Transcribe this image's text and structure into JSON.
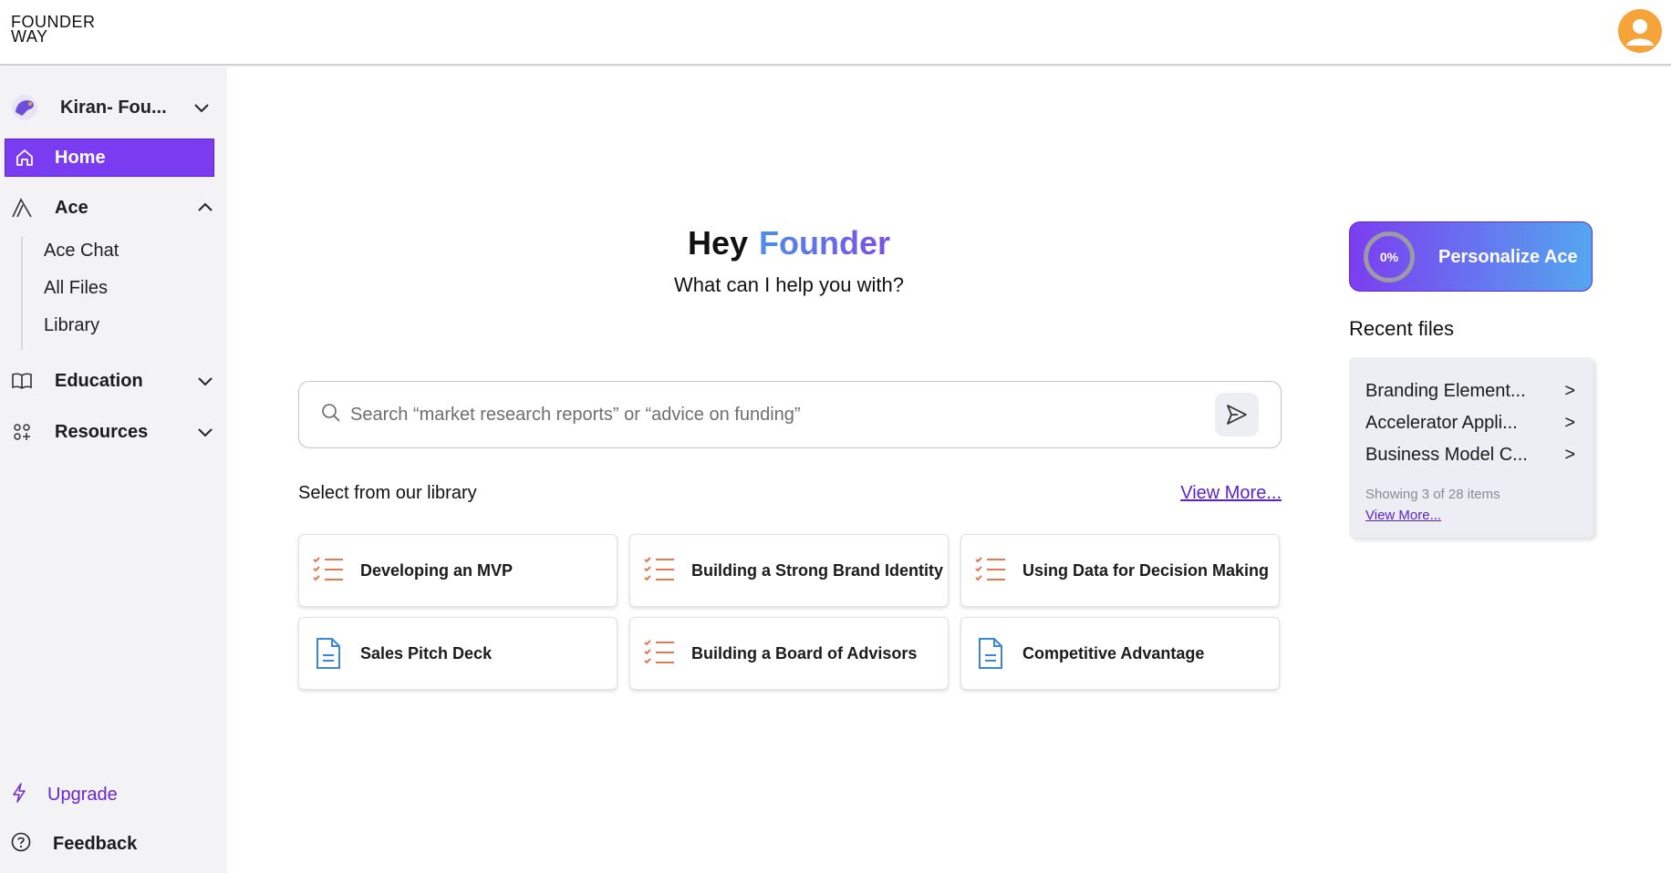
{
  "header": {
    "logo_line1": "FOUNDER",
    "logo_line2": "WAY",
    "avatar_icon": "user-avatar-icon"
  },
  "sidebar": {
    "workspace_name": "Kiran- Fou...",
    "home": "Home",
    "ace": "Ace",
    "ace_items": [
      "Ace Chat",
      "All Files",
      "Library"
    ],
    "education": "Education",
    "resources": "Resources",
    "upgrade": "Upgrade",
    "feedback": "Feedback"
  },
  "main": {
    "greeting_hey": "Hey",
    "greeting_name": "Founder",
    "subgreeting": "What can I help you with?",
    "search_placeholder": "Search “market research reports” or “advice on funding”",
    "library_title": "Select from our library",
    "view_more": "View More...",
    "cards": [
      {
        "label": "Developing an MVP",
        "icon": "checklist-icon"
      },
      {
        "label": "Building a Strong Brand Identity",
        "icon": "checklist-icon"
      },
      {
        "label": "Using Data for Decision Making",
        "icon": "checklist-icon"
      },
      {
        "label": "Sales Pitch Deck",
        "icon": "document-icon"
      },
      {
        "label": "Building a Board of Advisors",
        "icon": "checklist-icon"
      },
      {
        "label": "Competitive Advantage",
        "icon": "document-icon"
      }
    ]
  },
  "right": {
    "progress": "0%",
    "personalize": "Personalize Ace",
    "recent_title": "Recent files",
    "recent_files": [
      "Branding Element...",
      "Accelerator Appli...",
      "Business Model C..."
    ],
    "arrow": ">",
    "showing": "Showing 3 of 28 items",
    "view_more": "View More..."
  },
  "colors": {
    "accent": "#7a3cf0",
    "link": "#5b23c9",
    "card_icon_orange": "#e2794f",
    "card_icon_blue": "#3b86d6",
    "avatar": "#f6a33a"
  }
}
